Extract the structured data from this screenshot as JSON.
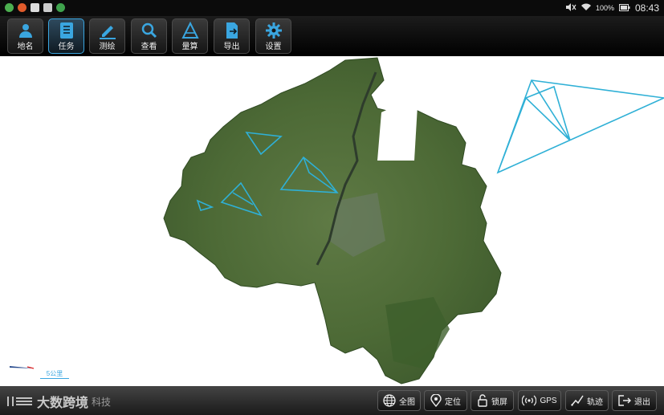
{
  "statusbar": {
    "battery": "100%",
    "time": "08:43"
  },
  "toolbar": {
    "buttons": [
      {
        "label": "地名",
        "icon": "person-pin-icon"
      },
      {
        "label": "任务",
        "icon": "task-list-icon"
      },
      {
        "label": "测绘",
        "icon": "pencil-icon"
      },
      {
        "label": "查看",
        "icon": "search-icon"
      },
      {
        "label": "量算",
        "icon": "measure-icon"
      },
      {
        "label": "导出",
        "icon": "export-icon"
      },
      {
        "label": "设置",
        "icon": "gear-icon"
      }
    ],
    "active_index": 1
  },
  "map": {
    "scale_label": "5公里"
  },
  "bottombar": {
    "buttons": [
      {
        "label": "全图",
        "icon": "globe-icon"
      },
      {
        "label": "定位",
        "icon": "location-pin-icon"
      },
      {
        "label": "锁屏",
        "icon": "lock-icon"
      },
      {
        "label": "GPS",
        "icon": "gps-signal-icon"
      },
      {
        "label": "轨迹",
        "icon": "track-icon"
      },
      {
        "label": "退出",
        "icon": "exit-icon"
      }
    ]
  },
  "watermark": {
    "brand": "大数跨境",
    "suffix": "科技"
  },
  "colors": {
    "accent": "#3aa6e0",
    "survey_lines": "#2fb0d6",
    "terrain": "#4d6a36"
  }
}
